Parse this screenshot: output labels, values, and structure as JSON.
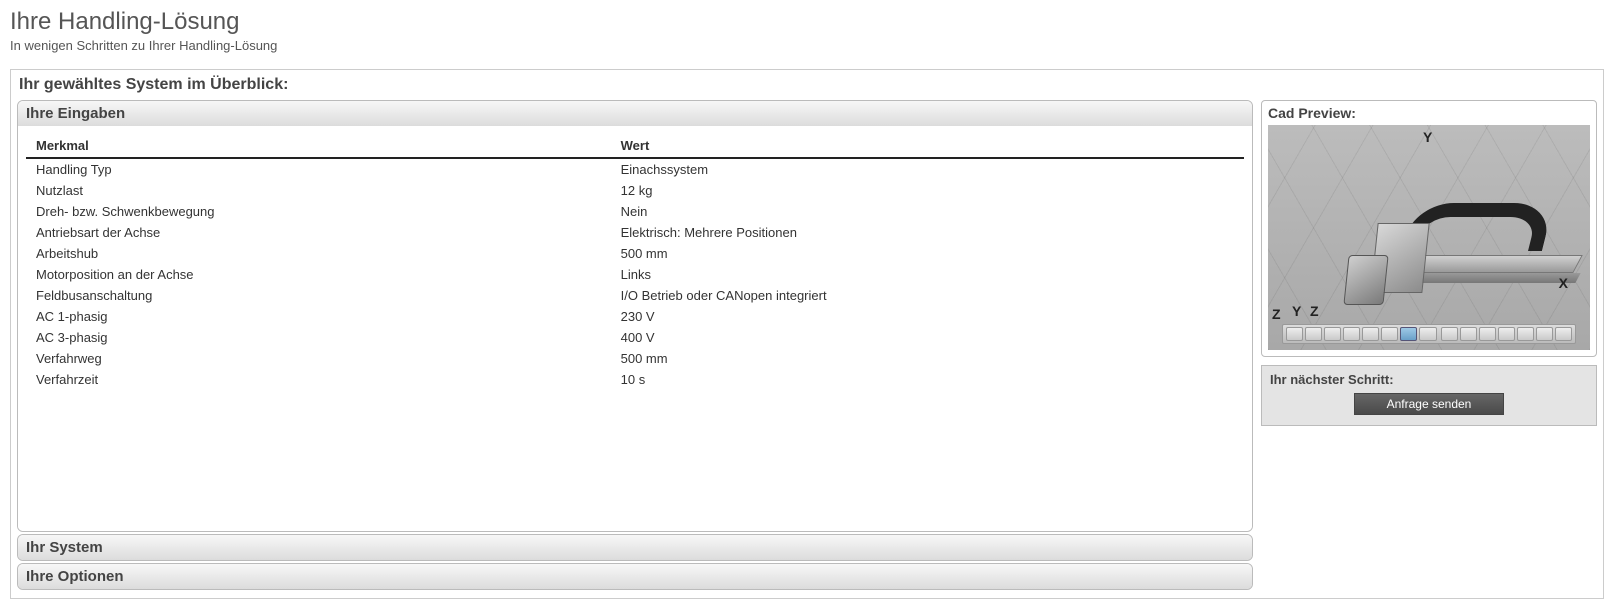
{
  "page": {
    "title": "Ihre Handling-Lösung",
    "subtitle": "In wenigen Schritten zu Ihrer Handling-Lösung"
  },
  "overview": {
    "heading": "Ihr gewähltes System im Überblick:"
  },
  "inputsPanel": {
    "title": "Ihre Eingaben",
    "columns": {
      "key": "Merkmal",
      "value": "Wert"
    },
    "rows": [
      {
        "key": "Handling Typ",
        "value": "Einachssystem"
      },
      {
        "key": "Nutzlast",
        "value": "12 kg"
      },
      {
        "key": "Dreh- bzw. Schwenkbewegung",
        "value": "Nein"
      },
      {
        "key": "Antriebsart der Achse",
        "value": "Elektrisch: Mehrere Positionen"
      },
      {
        "key": "Arbeitshub",
        "value": "500 mm"
      },
      {
        "key": "Motorposition an der Achse",
        "value": "Links"
      },
      {
        "key": "Feldbusanschaltung",
        "value": "I/O Betrieb oder CANopen integriert"
      },
      {
        "key": "AC 1-phasig",
        "value": "230 V"
      },
      {
        "key": "AC 3-phasig",
        "value": "400 V"
      },
      {
        "key": "Verfahrweg",
        "value": "500 mm"
      },
      {
        "key": "Verfahrzeit",
        "value": "10 s"
      }
    ]
  },
  "systemPanel": {
    "title": "Ihr System"
  },
  "optionsPanel": {
    "title": "Ihre Optionen"
  },
  "cadPreview": {
    "title": "Cad Preview:",
    "axes": {
      "y_top": "Y",
      "x_right": "X",
      "y_left": "Y",
      "z_left": "Z",
      "z_bottomleft": "Z"
    }
  },
  "nextStep": {
    "title": "Ihr nächster Schritt:",
    "button": "Anfrage senden"
  }
}
